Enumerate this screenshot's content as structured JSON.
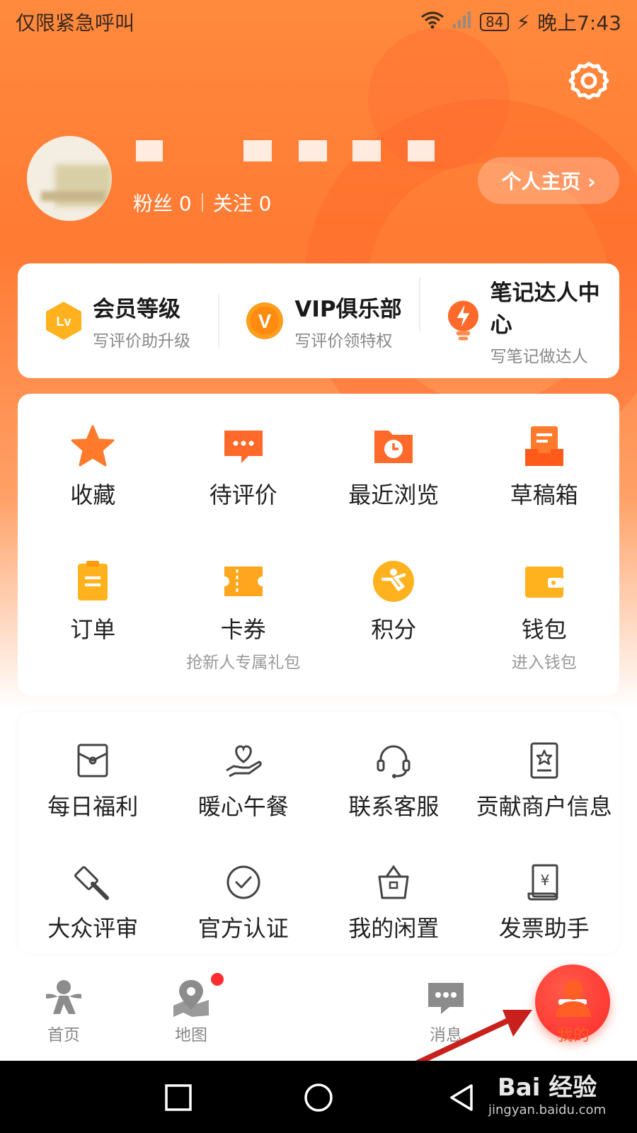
{
  "status_bar": {
    "left_text": "仅限紧急呼叫",
    "battery": "84",
    "time": "晚上7:43"
  },
  "profile": {
    "fans_label": "粉丝 0",
    "follow_label": "关注 0",
    "homepage_button": "个人主页 ›"
  },
  "member": {
    "items": [
      {
        "title": "会员等级",
        "sub": "写评价助升级",
        "icon_text": "Lv",
        "icon": "lv-badge-icon"
      },
      {
        "title": "VIP俱乐部",
        "sub": "写评价领特权",
        "icon_text": "V",
        "icon": "vip-badge-icon"
      },
      {
        "title": "笔记达人中心",
        "sub": "写笔记做达人",
        "icon": "bulb-bolt-icon"
      }
    ]
  },
  "services": {
    "items": [
      {
        "label": "收藏",
        "icon": "star-icon"
      },
      {
        "label": "待评价",
        "icon": "comment-icon"
      },
      {
        "label": "最近浏览",
        "icon": "history-folder-icon"
      },
      {
        "label": "草稿箱",
        "icon": "draft-box-icon"
      },
      {
        "label": "订单",
        "sub": "",
        "icon": "order-icon"
      },
      {
        "label": "卡券",
        "sub": "抢新人专属礼包",
        "icon": "coupon-icon"
      },
      {
        "label": "积分",
        "sub": "",
        "icon": "points-icon"
      },
      {
        "label": "钱包",
        "sub": "进入钱包",
        "icon": "wallet-icon"
      }
    ]
  },
  "tools": {
    "items": [
      {
        "label": "每日福利",
        "icon": "red-envelope-icon"
      },
      {
        "label": "暖心午餐",
        "icon": "heart-hand-icon"
      },
      {
        "label": "联系客服",
        "icon": "headset-icon"
      },
      {
        "label": "贡献商户信息",
        "icon": "shop-info-icon"
      },
      {
        "label": "大众评审",
        "icon": "gavel-icon"
      },
      {
        "label": "官方认证",
        "icon": "check-circle-icon"
      },
      {
        "label": "我的闲置",
        "icon": "bag-icon"
      },
      {
        "label": "发票助手",
        "icon": "invoice-icon"
      }
    ]
  },
  "bottom_nav": {
    "items": [
      {
        "label": "首页",
        "icon": "home-mascot-icon"
      },
      {
        "label": "地图",
        "icon": "map-pin-icon"
      },
      {
        "label": "消息",
        "icon": "message-icon"
      },
      {
        "label": "我的",
        "icon": "person-icon",
        "active": true
      }
    ]
  },
  "watermark": {
    "main": "Bai 经验",
    "sub": "jingyan.baidu.com"
  },
  "colors": {
    "accent": "#ff7a33",
    "active": "#ff5e24",
    "publish": "#ff2c2c"
  }
}
